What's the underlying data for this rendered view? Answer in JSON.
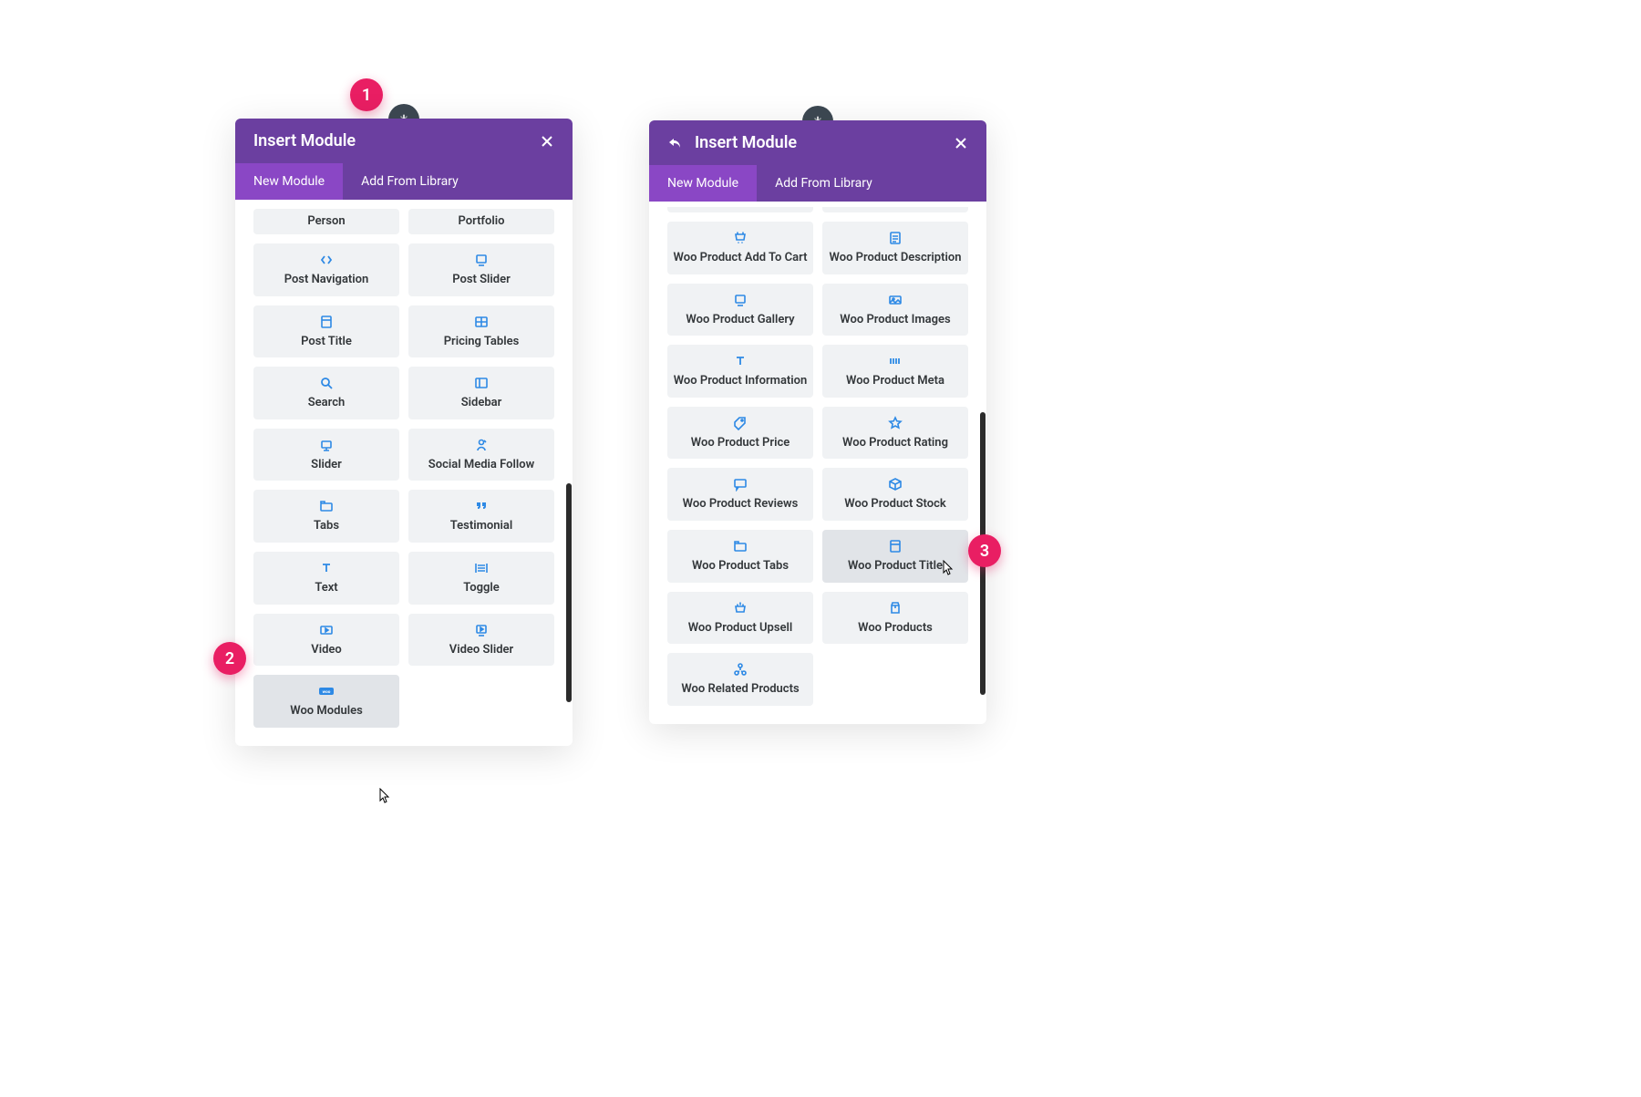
{
  "colors": {
    "header": "#6b3fa0",
    "tabActive": "#8a47c5",
    "accent": "#e91e63",
    "icon": "#2d89e5"
  },
  "markers": {
    "m1": "1",
    "m2": "2",
    "m3": "3"
  },
  "left": {
    "title": "Insert Module",
    "tabs": {
      "new": "New Module",
      "library": "Add From Library"
    },
    "modules": [
      {
        "label": "Person",
        "icon": "person"
      },
      {
        "label": "Portfolio",
        "icon": "grid"
      },
      {
        "label": "Post Navigation",
        "icon": "nav"
      },
      {
        "label": "Post Slider",
        "icon": "slide"
      },
      {
        "label": "Post Title",
        "icon": "title"
      },
      {
        "label": "Pricing Tables",
        "icon": "table"
      },
      {
        "label": "Search",
        "icon": "search"
      },
      {
        "label": "Sidebar",
        "icon": "sidebar"
      },
      {
        "label": "Slider",
        "icon": "slider"
      },
      {
        "label": "Social Media Follow",
        "icon": "social"
      },
      {
        "label": "Tabs",
        "icon": "tabs"
      },
      {
        "label": "Testimonial",
        "icon": "quote"
      },
      {
        "label": "Text",
        "icon": "text"
      },
      {
        "label": "Toggle",
        "icon": "toggle"
      },
      {
        "label": "Video",
        "icon": "video"
      },
      {
        "label": "Video Slider",
        "icon": "video-slider"
      },
      {
        "label": "Woo Modules",
        "icon": "woo",
        "hover": true
      }
    ]
  },
  "right": {
    "title": "Insert Module",
    "tabs": {
      "new": "New Module",
      "library": "Add From Library"
    },
    "modules": [
      {
        "label": "Woo Product Add To Cart",
        "icon": "cart"
      },
      {
        "label": "Woo Product Description",
        "icon": "desc"
      },
      {
        "label": "Woo Product Gallery",
        "icon": "gallery"
      },
      {
        "label": "Woo Product Images",
        "icon": "images"
      },
      {
        "label": "Woo Product Information",
        "icon": "info"
      },
      {
        "label": "Woo Product Meta",
        "icon": "meta"
      },
      {
        "label": "Woo Product Price",
        "icon": "price"
      },
      {
        "label": "Woo Product Rating",
        "icon": "rating"
      },
      {
        "label": "Woo Product Reviews",
        "icon": "reviews"
      },
      {
        "label": "Woo Product Stock",
        "icon": "stock"
      },
      {
        "label": "Woo Product Tabs",
        "icon": "ptabs"
      },
      {
        "label": "Woo Product Title",
        "icon": "ptitle",
        "hover": true
      },
      {
        "label": "Woo Product Upsell",
        "icon": "upsell"
      },
      {
        "label": "Woo Products",
        "icon": "products"
      },
      {
        "label": "Woo Related Products",
        "icon": "related"
      }
    ]
  }
}
